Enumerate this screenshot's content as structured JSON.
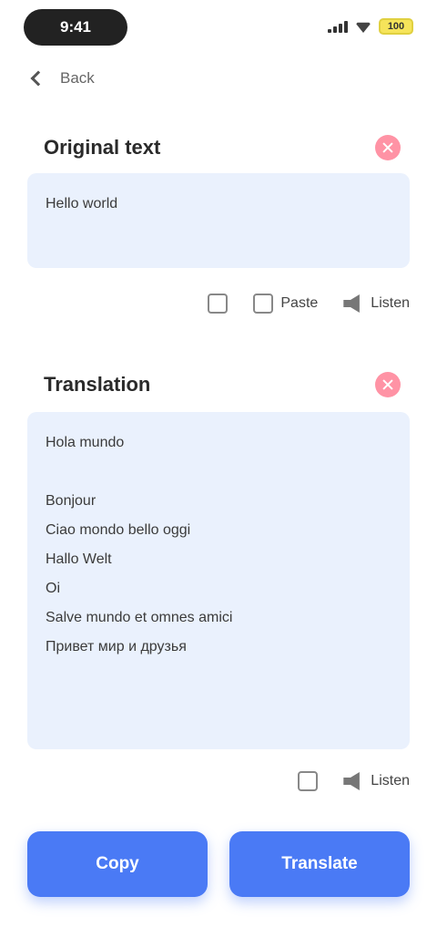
{
  "status_bar": {
    "time": "9:41",
    "battery": "100"
  },
  "nav": {
    "back_label": "Back"
  },
  "source_card": {
    "title": "Original text",
    "text": "Hello world",
    "tools": {
      "paste": "Paste",
      "listen": "Listen"
    }
  },
  "result_card": {
    "title": "Translation",
    "lines": [
      "Hola mundo",
      "",
      "Bonjour",
      "Ciao mondo bello oggi",
      "Hallo Welt",
      "Oi",
      "Salve mundo et omnes amici",
      "Привет мир и друзья"
    ],
    "tools": {
      "listen": "Listen"
    }
  },
  "bottom_bar": {
    "copy_label": "Copy",
    "translate_label": "Translate"
  },
  "colors": {
    "accent": "#4a7af5",
    "box_bg": "#eaf1fd",
    "clear": "#ff3b5c"
  }
}
